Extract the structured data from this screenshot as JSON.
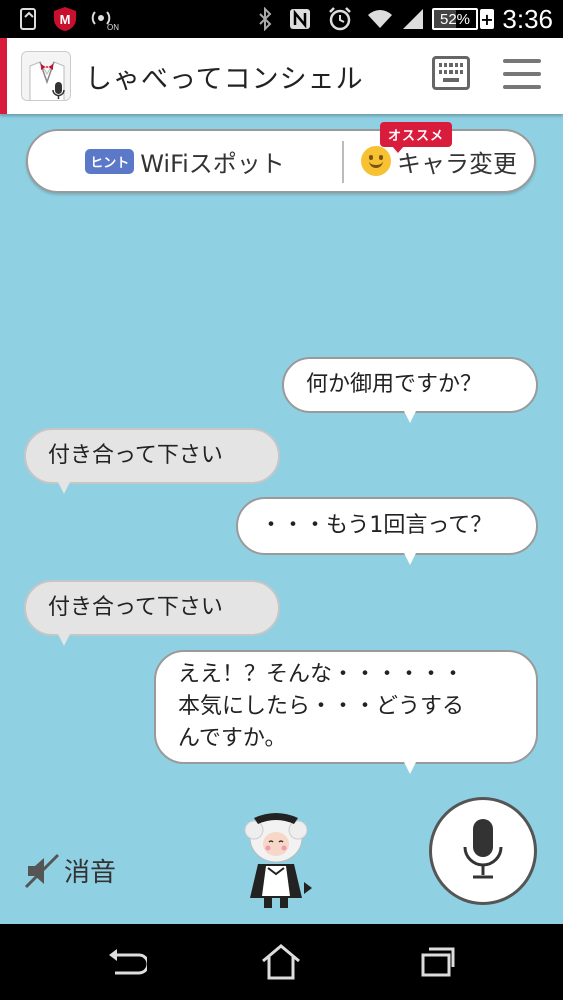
{
  "status_bar": {
    "time": "3:36",
    "battery_percent": 52,
    "battery_label": "52%",
    "battery_charging_symbol": "+",
    "mcafee_letter": "M",
    "icons": [
      "screenshot-icon",
      "mcafee-icon",
      "nfc-signal-icon",
      "bluetooth-icon",
      "nfc-icon",
      "alarm-icon",
      "wifi-icon",
      "cell-signal-icon",
      "battery-icon"
    ]
  },
  "app_bar": {
    "title": "しゃべってコンシェル",
    "icons": [
      "app-icon",
      "keyboard-icon",
      "menu-icon"
    ]
  },
  "top_pill": {
    "hint_badge": "ヒント",
    "wifi_label": "WiFiスポット",
    "recommend_badge": "オススメ",
    "chara_label": "キャラ変更"
  },
  "chat": {
    "messages": [
      {
        "side": "bot",
        "text": "何か御用ですか？"
      },
      {
        "side": "user",
        "text": "付き合って下さい"
      },
      {
        "side": "bot",
        "text": "・・・もう1回言って？"
      },
      {
        "side": "user",
        "text": "付き合って下さい"
      },
      {
        "side": "bot",
        "text": "ええ！？そんな・・・・・・\n本気にしたら・・・どうする\nんですか。"
      }
    ]
  },
  "bottom": {
    "mute_label": "消音",
    "icons": [
      "mute-icon",
      "mascot-character",
      "microphone-icon"
    ]
  },
  "nav_bar": {
    "icons": [
      "back-icon",
      "home-icon",
      "recent-apps-icon"
    ]
  },
  "colors": {
    "background": "#8fd0e3",
    "accent_red": "#d91c3c",
    "hint_blue": "#5b78c9",
    "smile_yellow": "#f6c233"
  }
}
